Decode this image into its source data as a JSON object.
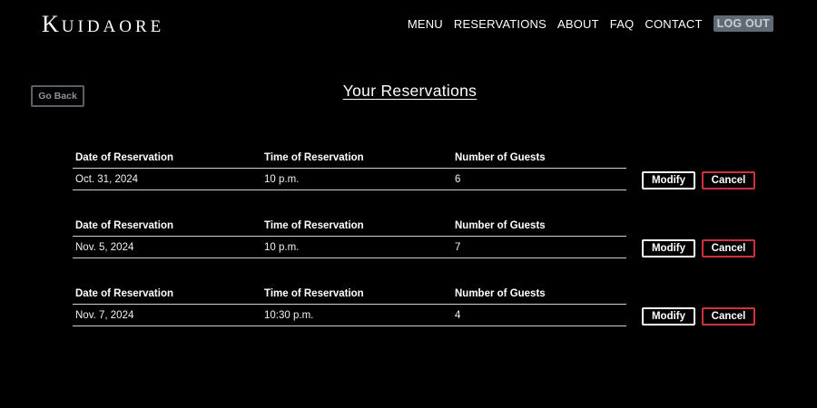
{
  "header": {
    "logo_first": "K",
    "logo_rest": "UIDAORE",
    "nav": [
      "MENU",
      "RESERVATIONS",
      "ABOUT",
      "FAQ",
      "CONTACT"
    ],
    "logout_label": "LOG OUT"
  },
  "page": {
    "go_back_label": "Go Back",
    "title": "Your Reservations"
  },
  "columns": {
    "date": "Date of Reservation",
    "time": "Time of Reservation",
    "guests": "Number of Guests"
  },
  "reservations": [
    {
      "date": "Oct. 31, 2024",
      "time": "10 p.m.",
      "guests": "6"
    },
    {
      "date": "Nov. 5, 2024",
      "time": "10 p.m.",
      "guests": "7"
    },
    {
      "date": "Nov. 7, 2024",
      "time": "10:30 p.m.",
      "guests": "4"
    }
  ],
  "actions": {
    "modify_label": "Modify",
    "cancel_label": "Cancel"
  },
  "colors": {
    "background": "#000000",
    "cancel_border": "#d1313d",
    "logout_bg": "#5f6a74"
  }
}
